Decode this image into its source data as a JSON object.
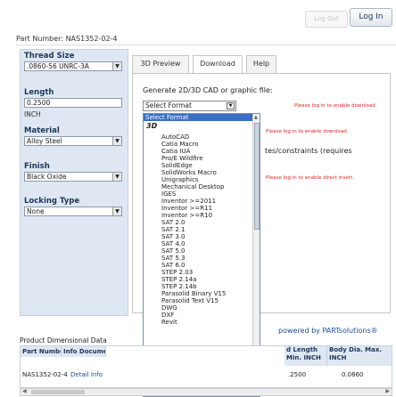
{
  "header": {
    "logout_label": "Log Out",
    "login_label": "Log In"
  },
  "part_number_label": "Part Number: NAS1352-02-4",
  "filters": {
    "thread_size": {
      "label": "Thread Size",
      "value": ".0860-56 UNRC-3A"
    },
    "length": {
      "label": "Length",
      "value": "0.2500",
      "unit": "INCH"
    },
    "material": {
      "label": "Material",
      "value": "Alloy Steel"
    },
    "finish": {
      "label": "Finish",
      "value": "Black Oxide"
    },
    "locking_type": {
      "label": "Locking Type",
      "value": "None"
    }
  },
  "tabs": [
    "3D Preview",
    "Download",
    "Help"
  ],
  "download": {
    "generate_label": "Generate 2D/3D CAD or graphic file:",
    "format_value": "Select Format",
    "login_notice_1": "Please log in to enable download.",
    "login_notice_2": "Please log in to enable download.",
    "login_notice_3": "Please log in to enable direct insert.",
    "partial_text": "tes/constraints (requires"
  },
  "format_dropdown": {
    "highlighted": "Select Format",
    "group": "3D",
    "items": [
      "AutoCAD",
      "Catia Macro",
      "Catia IUA",
      "Pro/E Wildfire",
      "SolidEdge",
      "SolidWorks Macro",
      "Unigraphics",
      "Mechanical Desktop",
      "IGES",
      "Inventor >=2011",
      "Inventor >=R11",
      "Inventor >=R10",
      "SAT 2.0",
      "SAT 2.1",
      "SAT 3.0",
      "SAT 4.0",
      "SAT 5.0",
      "SAT 5.3",
      "SAT 6.0",
      "STEP 2.03",
      "STEP 2.14a",
      "STEP 2.14b",
      "Parasolid Binary V15",
      "Parasolid Text V15",
      "DWG",
      "DXF",
      "Revit"
    ]
  },
  "powered_by": "powered by PARTsolutions®",
  "dimensional_table": {
    "title": "Product Dimensional Data",
    "columns": [
      "Part Number",
      "Info Document",
      "d Length Min. INCH",
      "Body Dia. Max. INCH"
    ],
    "row": [
      "NAS1352-02-4",
      "Detail Info",
      ".2500",
      "0.0860"
    ]
  }
}
